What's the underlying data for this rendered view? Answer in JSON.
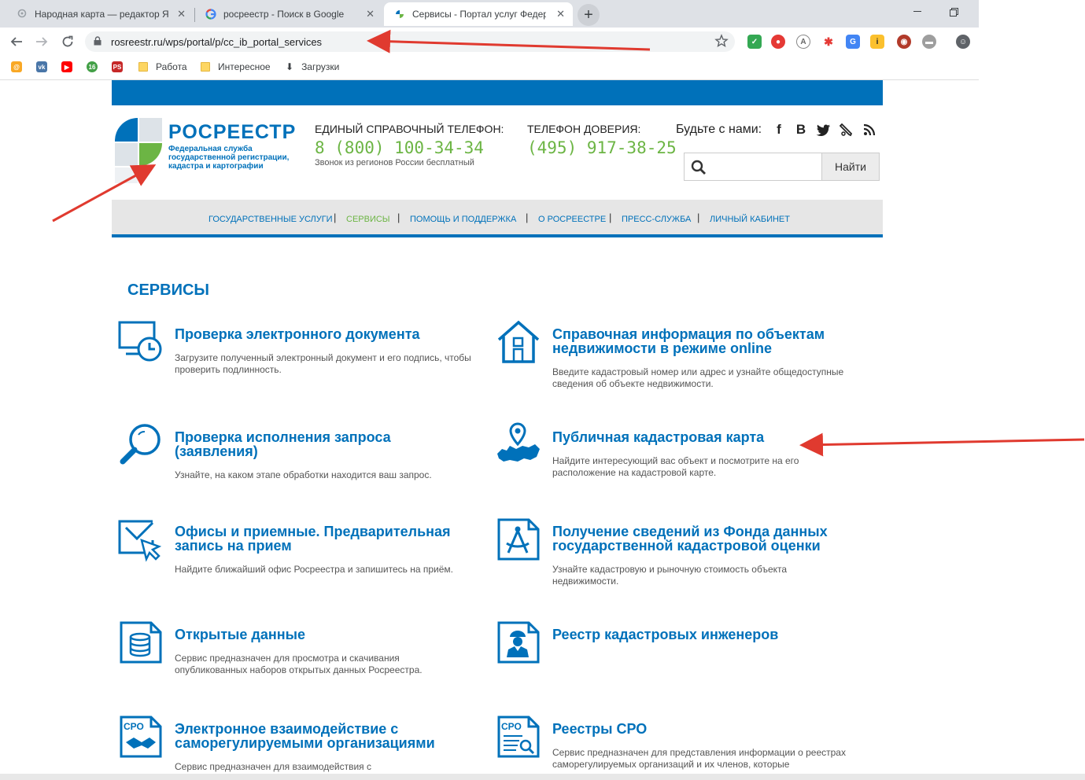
{
  "browser": {
    "tabs": [
      {
        "title": "Народная карта — редактор Ян",
        "close": "✕"
      },
      {
        "title": "росреестр - Поиск в Google",
        "close": "✕"
      },
      {
        "title": "Сервисы - Портал услуг Федера",
        "close": "✕"
      }
    ],
    "new_tab": "+",
    "url": "rosreestr.ru/wps/portal/p/cc_ib_portal_services",
    "bookmarks": [
      "Работа",
      "Интересное",
      "Загрузки"
    ]
  },
  "header": {
    "logo_name": "РОСРЕЕСТР",
    "logo_sub": "Федеральная служба государственной регистрации, кадастра и картографии",
    "hotline_label": "ЕДИНЫЙ СПРАВОЧНЫЙ ТЕЛЕФОН:",
    "hotline_phone": "8 (800) 100-34-34",
    "hotline_note": "Звонок из регионов России бесплатный",
    "trust_label": "ТЕЛЕФОН ДОВЕРИЯ:",
    "trust_phone": "(495) 917-38-25",
    "social_label": "Будьте с нами:",
    "search_button": "Найти"
  },
  "nav": [
    "ГОСУДАРСТВЕННЫЕ УСЛУГИ",
    "СЕРВИСЫ",
    "ПОМОЩЬ И ПОДДЕРЖКА",
    "О РОСРЕЕСТРЕ",
    "ПРЕСС-СЛУЖБА",
    "ЛИЧНЫЙ КАБИНЕТ"
  ],
  "nav_active": "СЕРВИСЫ",
  "section_title": "СЕРВИСЫ",
  "services": [
    {
      "title": "Проверка электронного документа",
      "desc": "Загрузите полученный электронный документ и его подпись, чтобы проверить подлинность."
    },
    {
      "title": "Справочная информация по объектам недвижимости в режиме online",
      "desc": "Введите кадастровый номер или адрес и узнайте общедоступные сведения об объекте недвижимости."
    },
    {
      "title": "Проверка исполнения запроса (заявления)",
      "desc": "Узнайте, на каком этапе обработки находится ваш запрос."
    },
    {
      "title": "Публичная кадастровая карта",
      "desc": "Найдите интересующий вас объект и посмотрите на его расположение на кадастровой карте."
    },
    {
      "title": "Офисы и приемные. Предварительная запись на прием",
      "desc": "Найдите ближайший офис Росреестра и запишитесь на приём."
    },
    {
      "title": "Получение сведений из Фонда данных государственной кадастровой оценки",
      "desc": "Узнайте кадастровую и рыночную стоимость объекта недвижимости."
    },
    {
      "title": "Открытые данные",
      "desc": "Сервис предназначен для просмотра и скачивания опубликованных наборов открытых данных Росреестра."
    },
    {
      "title": "Реестр кадастровых инженеров",
      "desc": ""
    },
    {
      "title": "Электронное взаимодействие с саморегулируемыми организациями",
      "desc": "Сервис предназначен для взаимодействия с"
    },
    {
      "title": "Реестры СРО",
      "desc": "Сервис предназначен для представления информации о реестрах саморегулируемых организаций и их членов, которые"
    }
  ],
  "colors": {
    "brand": "#0071ba",
    "green": "#6cb544",
    "annotation": "#e03a2f"
  }
}
